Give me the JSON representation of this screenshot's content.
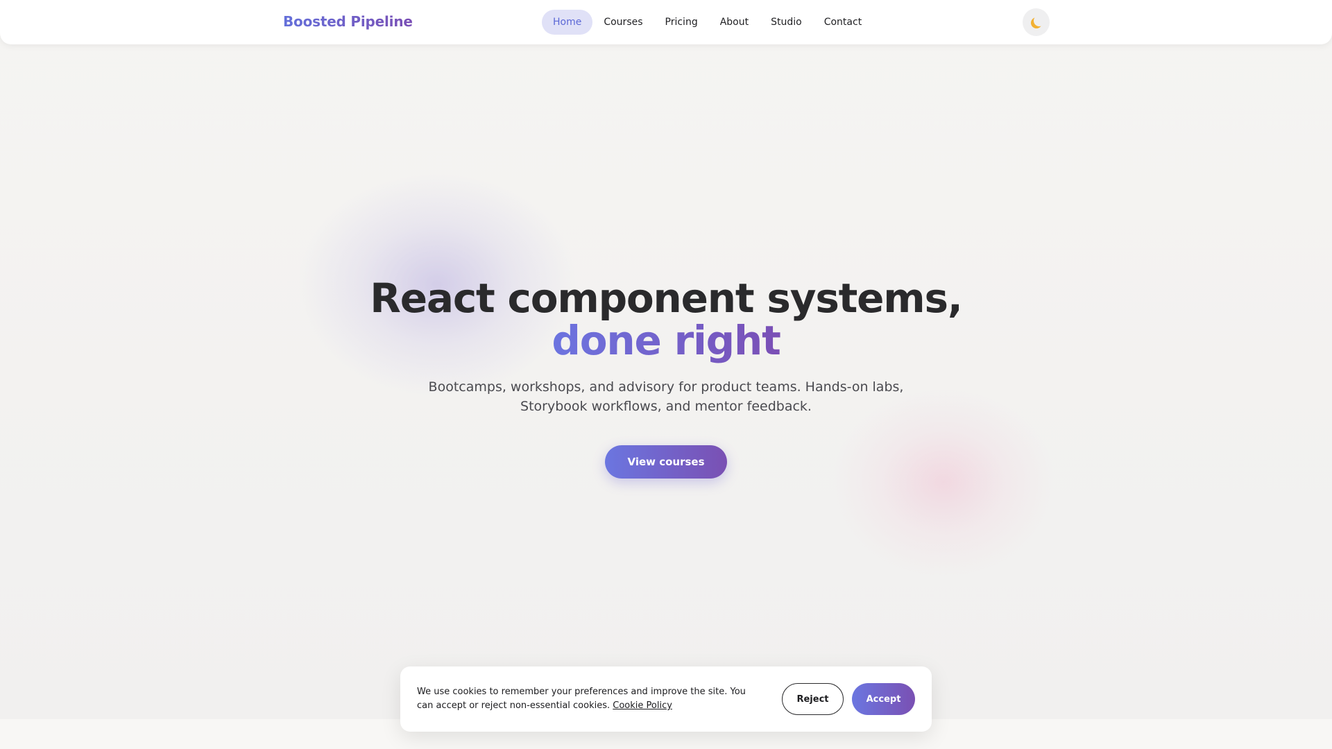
{
  "brand": {
    "name": "Boosted Pipeline"
  },
  "nav": {
    "items": [
      {
        "label": "Home",
        "active": true
      },
      {
        "label": "Courses"
      },
      {
        "label": "Pricing"
      },
      {
        "label": "About"
      },
      {
        "label": "Studio"
      },
      {
        "label": "Contact"
      }
    ],
    "theme_toggle_icon": "moon-icon"
  },
  "hero": {
    "title_line1": "React component systems,",
    "title_accent": "done right",
    "subtitle_line1": "Bootcamps, workshops, and advisory for product teams. Hands-on labs,",
    "subtitle_line2": "Storybook workflows, and mentor feedback.",
    "cta_label": "View courses"
  },
  "cookie_banner": {
    "text": "We use cookies to remember your preferences and improve the site. You can accept or reject non-essential cookies.",
    "link_label": "Cookie Policy",
    "reject_label": "Reject",
    "accept_label": "Accept"
  },
  "colors": {
    "accent_start": "#6b76e0",
    "accent_end": "#7a50b3",
    "nav_active_bg": "#e0e1f7",
    "text_dark": "#2a2a2c"
  }
}
